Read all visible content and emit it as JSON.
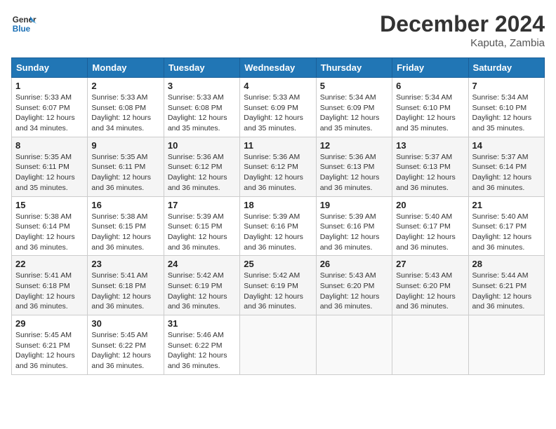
{
  "header": {
    "logo_general": "General",
    "logo_blue": "Blue",
    "month_title": "December 2024",
    "location": "Kaputa, Zambia"
  },
  "weekdays": [
    "Sunday",
    "Monday",
    "Tuesday",
    "Wednesday",
    "Thursday",
    "Friday",
    "Saturday"
  ],
  "weeks": [
    [
      {
        "day": "1",
        "sunrise": "5:33 AM",
        "sunset": "6:07 PM",
        "daylight": "12 hours and 34 minutes."
      },
      {
        "day": "2",
        "sunrise": "5:33 AM",
        "sunset": "6:08 PM",
        "daylight": "12 hours and 34 minutes."
      },
      {
        "day": "3",
        "sunrise": "5:33 AM",
        "sunset": "6:08 PM",
        "daylight": "12 hours and 35 minutes."
      },
      {
        "day": "4",
        "sunrise": "5:33 AM",
        "sunset": "6:09 PM",
        "daylight": "12 hours and 35 minutes."
      },
      {
        "day": "5",
        "sunrise": "5:34 AM",
        "sunset": "6:09 PM",
        "daylight": "12 hours and 35 minutes."
      },
      {
        "day": "6",
        "sunrise": "5:34 AM",
        "sunset": "6:10 PM",
        "daylight": "12 hours and 35 minutes."
      },
      {
        "day": "7",
        "sunrise": "5:34 AM",
        "sunset": "6:10 PM",
        "daylight": "12 hours and 35 minutes."
      }
    ],
    [
      {
        "day": "8",
        "sunrise": "5:35 AM",
        "sunset": "6:11 PM",
        "daylight": "12 hours and 35 minutes."
      },
      {
        "day": "9",
        "sunrise": "5:35 AM",
        "sunset": "6:11 PM",
        "daylight": "12 hours and 36 minutes."
      },
      {
        "day": "10",
        "sunrise": "5:36 AM",
        "sunset": "6:12 PM",
        "daylight": "12 hours and 36 minutes."
      },
      {
        "day": "11",
        "sunrise": "5:36 AM",
        "sunset": "6:12 PM",
        "daylight": "12 hours and 36 minutes."
      },
      {
        "day": "12",
        "sunrise": "5:36 AM",
        "sunset": "6:13 PM",
        "daylight": "12 hours and 36 minutes."
      },
      {
        "day": "13",
        "sunrise": "5:37 AM",
        "sunset": "6:13 PM",
        "daylight": "12 hours and 36 minutes."
      },
      {
        "day": "14",
        "sunrise": "5:37 AM",
        "sunset": "6:14 PM",
        "daylight": "12 hours and 36 minutes."
      }
    ],
    [
      {
        "day": "15",
        "sunrise": "5:38 AM",
        "sunset": "6:14 PM",
        "daylight": "12 hours and 36 minutes."
      },
      {
        "day": "16",
        "sunrise": "5:38 AM",
        "sunset": "6:15 PM",
        "daylight": "12 hours and 36 minutes."
      },
      {
        "day": "17",
        "sunrise": "5:39 AM",
        "sunset": "6:15 PM",
        "daylight": "12 hours and 36 minutes."
      },
      {
        "day": "18",
        "sunrise": "5:39 AM",
        "sunset": "6:16 PM",
        "daylight": "12 hours and 36 minutes."
      },
      {
        "day": "19",
        "sunrise": "5:39 AM",
        "sunset": "6:16 PM",
        "daylight": "12 hours and 36 minutes."
      },
      {
        "day": "20",
        "sunrise": "5:40 AM",
        "sunset": "6:17 PM",
        "daylight": "12 hours and 36 minutes."
      },
      {
        "day": "21",
        "sunrise": "5:40 AM",
        "sunset": "6:17 PM",
        "daylight": "12 hours and 36 minutes."
      }
    ],
    [
      {
        "day": "22",
        "sunrise": "5:41 AM",
        "sunset": "6:18 PM",
        "daylight": "12 hours and 36 minutes."
      },
      {
        "day": "23",
        "sunrise": "5:41 AM",
        "sunset": "6:18 PM",
        "daylight": "12 hours and 36 minutes."
      },
      {
        "day": "24",
        "sunrise": "5:42 AM",
        "sunset": "6:19 PM",
        "daylight": "12 hours and 36 minutes."
      },
      {
        "day": "25",
        "sunrise": "5:42 AM",
        "sunset": "6:19 PM",
        "daylight": "12 hours and 36 minutes."
      },
      {
        "day": "26",
        "sunrise": "5:43 AM",
        "sunset": "6:20 PM",
        "daylight": "12 hours and 36 minutes."
      },
      {
        "day": "27",
        "sunrise": "5:43 AM",
        "sunset": "6:20 PM",
        "daylight": "12 hours and 36 minutes."
      },
      {
        "day": "28",
        "sunrise": "5:44 AM",
        "sunset": "6:21 PM",
        "daylight": "12 hours and 36 minutes."
      }
    ],
    [
      {
        "day": "29",
        "sunrise": "5:45 AM",
        "sunset": "6:21 PM",
        "daylight": "12 hours and 36 minutes."
      },
      {
        "day": "30",
        "sunrise": "5:45 AM",
        "sunset": "6:22 PM",
        "daylight": "12 hours and 36 minutes."
      },
      {
        "day": "31",
        "sunrise": "5:46 AM",
        "sunset": "6:22 PM",
        "daylight": "12 hours and 36 minutes."
      },
      null,
      null,
      null,
      null
    ]
  ],
  "labels": {
    "sunrise": "Sunrise:",
    "sunset": "Sunset:",
    "daylight": "Daylight:"
  }
}
